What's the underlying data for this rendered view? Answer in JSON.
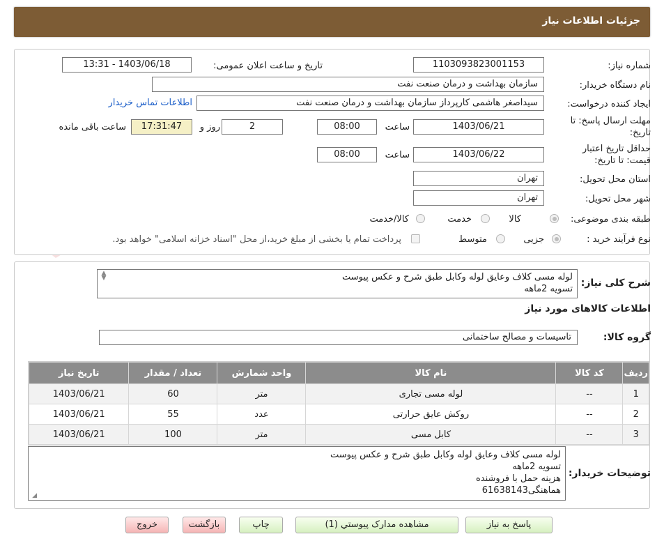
{
  "header": {
    "title": "جزئیات اطلاعات نیاز"
  },
  "watermark": {
    "text": "AriaTender.neT"
  },
  "form": {
    "need_number_label": "شماره نیاز:",
    "need_number": "1103093823001153",
    "announce_label": "تاریخ و ساعت اعلان عمومی:",
    "announce_value": "1403/06/18 - 13:31",
    "buyer_org_label": "نام دستگاه خریدار:",
    "buyer_org": "سازمان بهداشت و درمان صنعت نفت",
    "requester_label": "ایجاد کننده درخواست:",
    "requester": "سیداصغر هاشمی کارپرداز سازمان بهداشت و درمان صنعت نفت",
    "contact_link": "اطلاعات تماس خریدار",
    "deadline_label_1": "مهلت ارسال پاسخ: تا",
    "deadline_label_2": "تاریخ:",
    "deadline_date": "1403/06/21",
    "time_label": "ساعت",
    "deadline_time": "08:00",
    "days_value": "2",
    "days_label": "روز و",
    "remaining_time": "17:31:47",
    "remaining_label": "ساعت باقی مانده",
    "validity_label_1": "حداقل تاریخ اعتبار",
    "validity_label_2": "قیمت: تا تاریخ:",
    "validity_date": "1403/06/22",
    "validity_time": "08:00",
    "province_label": "استان محل تحویل:",
    "province": "تهران",
    "city_label": "شهر محل تحویل:",
    "city": "تهران",
    "category_label": "طبقه بندی موضوعی:",
    "category_options": [
      "کالا",
      "خدمت",
      "کالا/خدمت"
    ],
    "process_label": "نوع فرآیند خرید :",
    "process_options": [
      "جزیی",
      "متوسط"
    ],
    "payment_note": "پرداخت تمام یا بخشی از مبلغ خرید،از محل \"اسناد خزانه اسلامی\" خواهد بود."
  },
  "summary": {
    "label": "شرح کلی نیاز:",
    "line1": "لوله مسی کلاف وعایق لوله وکابل طبق شرح و عکس پیوست",
    "line2": "تسویه 2ماهه",
    "items_title": "اطلاعات کالاهای مورد نیاز",
    "group_label": "گروه کالا:",
    "group_value": "تاسیسات و مصالح ساختمانی"
  },
  "table": {
    "headers": [
      "ردیف",
      "کد کالا",
      "نام کالا",
      "واحد شمارش",
      "تعداد / مقدار",
      "تاریخ نیاز"
    ],
    "rows": [
      [
        "1",
        "--",
        "لوله مسی تجاری",
        "متر",
        "60",
        "1403/06/21"
      ],
      [
        "2",
        "--",
        "روکش عایق حرارتی",
        "عدد",
        "55",
        "1403/06/21"
      ],
      [
        "3",
        "--",
        "کابل مسی",
        "متر",
        "100",
        "1403/06/21"
      ]
    ]
  },
  "notes": {
    "label": "توضیحات خریدار:",
    "line1": "لوله مسی کلاف وعایق لوله وکابل طبق شرح و عکس پیوست",
    "line2": "تسویه 2ماهه",
    "line3": "هزینه حمل با فروشنده",
    "line4": "هماهنگی61638143"
  },
  "buttons": {
    "reply": "پاسخ به نیاز",
    "attachments": "مشاهده مدارک پیوستي (1)",
    "print": "چاپ",
    "back": "بازگشت",
    "exit": "خروج"
  }
}
